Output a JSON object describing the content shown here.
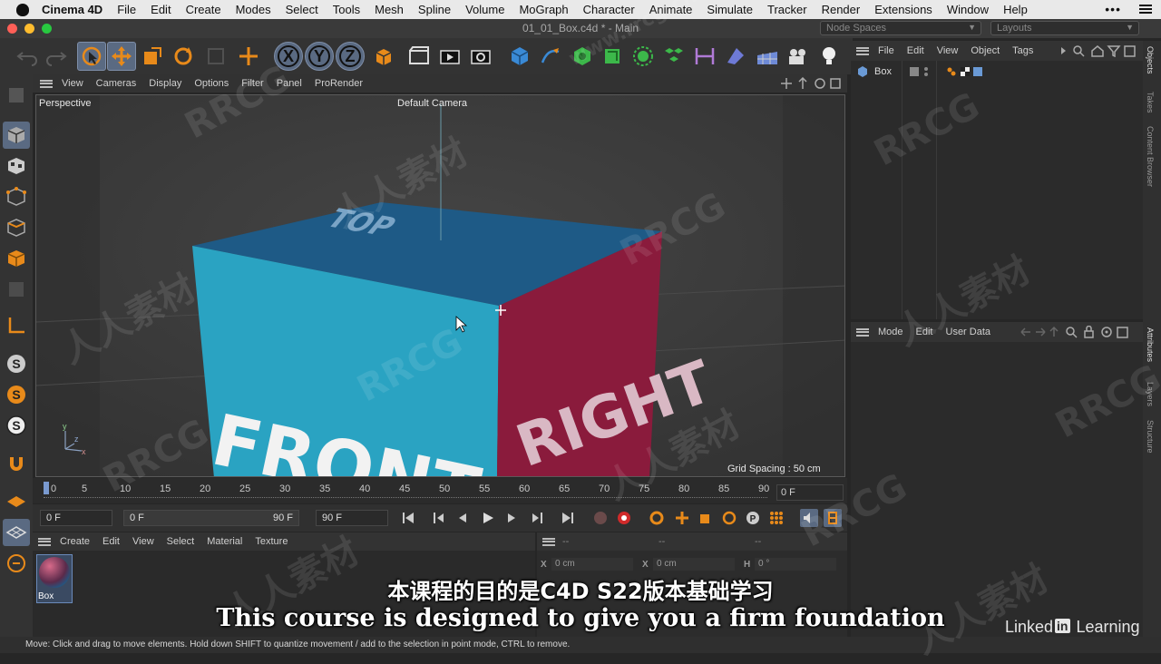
{
  "menubar": {
    "app": "Cinema 4D",
    "items": [
      "File",
      "Edit",
      "Create",
      "Modes",
      "Select",
      "Tools",
      "Mesh",
      "Spline",
      "Volume",
      "MoGraph",
      "Character",
      "Animate",
      "Simulate",
      "Tracker",
      "Render",
      "Extensions",
      "Window",
      "Help"
    ],
    "more": "•••"
  },
  "window": {
    "title": "01_01_Box.c4d * - Main",
    "node_spaces": "Node Spaces",
    "layouts": "Layouts"
  },
  "axis_buttons": [
    "X",
    "Y",
    "Z"
  ],
  "viewport": {
    "menu": [
      "View",
      "Cameras",
      "Display",
      "Options",
      "Filter",
      "Panel",
      "ProRender"
    ],
    "view_name": "Perspective",
    "camera": "Default Camera",
    "grid_spacing": "Grid Spacing : 50 cm",
    "cube_labels": {
      "top": "TOP",
      "front": "FRONT",
      "right": "RIGHT"
    },
    "colors": {
      "top": "#1e5a86",
      "front": "#2aa3c2",
      "right": "#8a1b3c",
      "bg": "#3e3e3e"
    }
  },
  "timeline": {
    "ticks": [
      "0",
      "5",
      "10",
      "15",
      "20",
      "25",
      "30",
      "35",
      "40",
      "45",
      "50",
      "55",
      "60",
      "65",
      "70",
      "75",
      "80",
      "85",
      "90"
    ],
    "current_frame": "0 F",
    "start": "0 F",
    "range_start": "0 F",
    "range_end": "90 F",
    "end": "90 F"
  },
  "material_manager": {
    "menu": [
      "Create",
      "Edit",
      "View",
      "Select",
      "Material",
      "Texture"
    ],
    "material_name": "Box"
  },
  "coordinates": {
    "header": [
      "--",
      "--",
      "--"
    ],
    "rows": [
      {
        "a": "X",
        "a_val": "0 cm",
        "b": "X",
        "b_val": "0 cm",
        "c": "H",
        "c_val": "0 °"
      }
    ]
  },
  "object_manager": {
    "menu": [
      "File",
      "Edit",
      "View",
      "Object",
      "Tags"
    ],
    "objects": [
      {
        "name": "Box"
      }
    ]
  },
  "attributes": {
    "menu": [
      "Mode",
      "Edit",
      "User Data"
    ]
  },
  "side_tabs": {
    "top": [
      "Objects",
      "Takes",
      "Content Browser"
    ],
    "bottom": [
      "Attributes",
      "Layers",
      "Structure"
    ]
  },
  "status": "Move: Click and drag to move elements. Hold down SHIFT to quantize movement / add to the selection in point mode, CTRL to remove.",
  "subtitles": {
    "cn": "本课程的目的是C4D S22版本基础学习",
    "en": "This course is designed to give you a firm foundation"
  },
  "brand": {
    "pre": "Linked",
    "in": "in",
    "post": " Learning"
  },
  "watermarks": [
    "RRCG",
    "人人素材",
    "www.rrcg.cn"
  ]
}
